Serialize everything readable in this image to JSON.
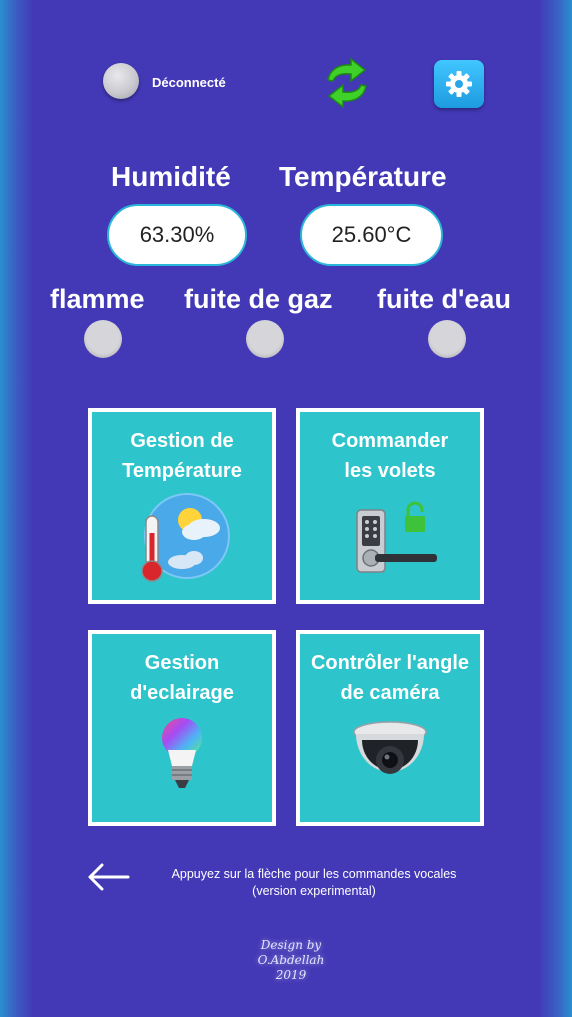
{
  "status": {
    "connection_label": "Déconnecté"
  },
  "toolbar": {
    "refresh_icon": "refresh-icon",
    "settings_icon": "gear-icon"
  },
  "sensors": {
    "humidity_label": "Humidité",
    "humidity_value": "63.30%",
    "temperature_label": "Température",
    "temperature_value": "25.60°C"
  },
  "alarms": [
    {
      "label": "flamme"
    },
    {
      "label": "fuite de gaz"
    },
    {
      "label": "fuite d'eau"
    }
  ],
  "tiles": [
    {
      "line1": "Gestion de",
      "line2": "Température",
      "icon": "thermometer-weather-icon"
    },
    {
      "line1": "Commander",
      "line2": "les volets",
      "icon": "smart-lock-icon"
    },
    {
      "line1": "Gestion",
      "line2": "d'eclairage",
      "icon": "light-bulb-icon"
    },
    {
      "line1": "Contrôler l'angle",
      "line2": "de caméra",
      "icon": "dome-camera-icon"
    }
  ],
  "footer": {
    "hint_line1": "Appuyez sur la flèche pour les commandes vocales",
    "hint_line2": "(version experimental)",
    "signature_line1": "Design by",
    "signature_line2": "O.Abdellah",
    "signature_line3": "2019"
  },
  "colors": {
    "background": "#4338b6",
    "tile": "#2ec4cb",
    "accent": "#41c6ff"
  }
}
